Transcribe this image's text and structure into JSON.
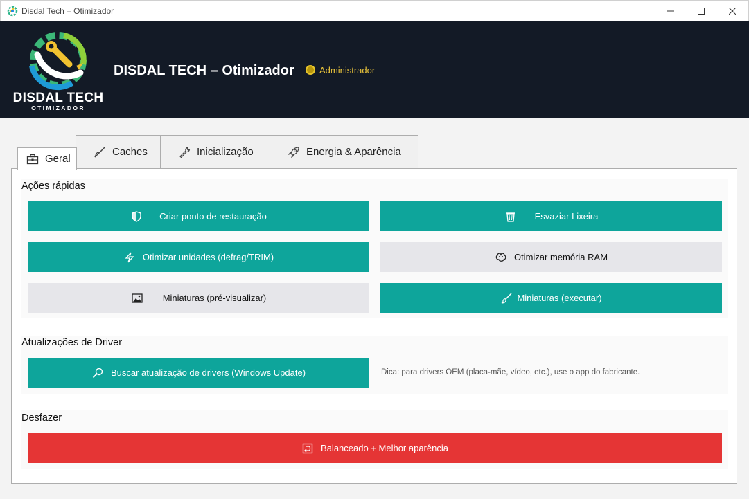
{
  "window": {
    "title": "Disdal Tech – Otimizador",
    "minimize": "—",
    "maximize": "☐",
    "close": "✕"
  },
  "header": {
    "logo_main": "DISDAL TECH",
    "logo_sub": "OTIMIZADOR",
    "title": "DISDAL TECH – Otimizador",
    "role": "Administrador",
    "colors": {
      "background": "#131a26",
      "role": "#e8c23a"
    }
  },
  "tabs": [
    {
      "label": "Geral",
      "icon": "toolbox-icon",
      "active": true
    },
    {
      "label": "Caches",
      "icon": "broom-icon",
      "active": false
    },
    {
      "label": "Inicialização",
      "icon": "wrench-icon",
      "active": false
    },
    {
      "label": "Energia & Aparência",
      "icon": "rocket-icon",
      "active": false
    }
  ],
  "quick_actions": {
    "label": "Ações rápidas",
    "buttons": [
      {
        "label": "Criar ponto de restauração",
        "icon": "shield-icon",
        "style": "teal"
      },
      {
        "label": "Esvaziar Lixeira",
        "icon": "trash-icon",
        "style": "teal"
      },
      {
        "label": "Otimizar unidades (defrag/TRIM)",
        "icon": "lightning-icon",
        "style": "teal"
      },
      {
        "label": "Otimizar memória RAM",
        "icon": "brain-icon",
        "style": "gray"
      },
      {
        "label": "Miniaturas (pré-visualizar)",
        "icon": "image-icon",
        "style": "gray"
      },
      {
        "label": "Miniaturas (executar)",
        "icon": "brush-icon",
        "style": "teal"
      }
    ]
  },
  "drivers": {
    "label": "Atualizações de Driver",
    "button": {
      "label": "Buscar atualização de drivers (Windows Update)",
      "icon": "magnifier-icon"
    },
    "hint": "Dica: para drivers OEM (placa-mãe, vídeo, etc.), use o app do fabricante."
  },
  "undo": {
    "label": "Desfazer",
    "button": {
      "label": "Balanceado + Melhor aparência",
      "icon": "undo-icon"
    }
  },
  "colors": {
    "teal": "#0ea59b",
    "gray": "#e6e6ea",
    "red": "#e53535"
  }
}
